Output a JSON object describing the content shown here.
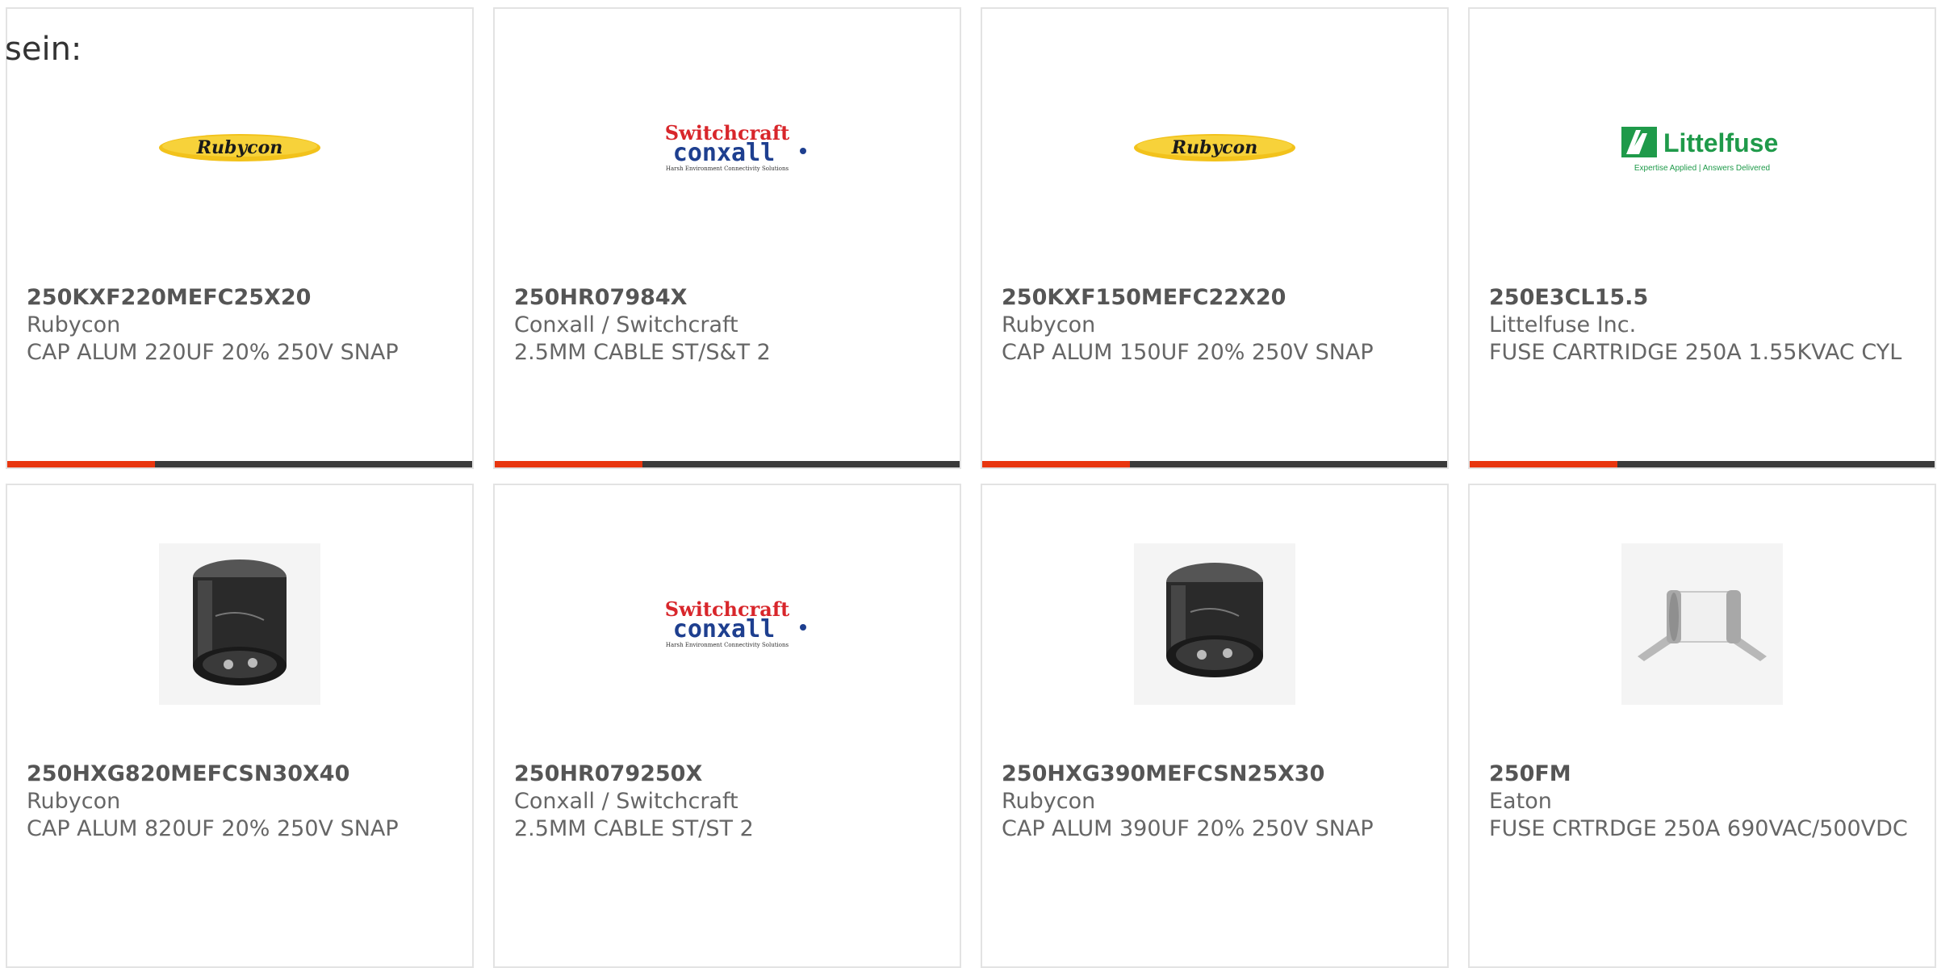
{
  "intro_text": "sein:",
  "colors": {
    "accent": "#e8360f",
    "bar": "#3a3a3a",
    "border": "#e3e3e3",
    "text": "#666666"
  },
  "products": [
    {
      "part_number": "250KXF220MEFC25X20",
      "manufacturer": "Rubycon",
      "description": "CAP ALUM 220UF 20% 250V SNAP",
      "image": "rubycon-logo",
      "logo_text": "Rubycon"
    },
    {
      "part_number": "250HR07984X",
      "manufacturer": "Conxall / Switchcraft",
      "description": "2.5MM CABLE ST/S&T 2",
      "image": "switchcraft-conxall-logo",
      "logo_text": "Switchcraft",
      "logo_text2": "conxall",
      "logo_tagline": "Harsh Environment Connectivity Solutions"
    },
    {
      "part_number": "250KXF150MEFC22X20",
      "manufacturer": "Rubycon",
      "description": "CAP ALUM 150UF 20% 250V SNAP",
      "image": "rubycon-logo",
      "logo_text": "Rubycon"
    },
    {
      "part_number": "250E3CL15.5",
      "manufacturer": "Littelfuse Inc.",
      "description": "FUSE CARTRIDGE 250A 1.55KVAC CYL",
      "image": "littelfuse-logo",
      "logo_text": "Littelfuse",
      "logo_tagline": "Expertise Applied | Answers Delivered"
    },
    {
      "part_number": "250HXG820MEFCSN30X40",
      "manufacturer": "Rubycon",
      "description": "CAP ALUM 820UF 20% 250V SNAP",
      "image": "capacitor-photo"
    },
    {
      "part_number": "250HR079250X",
      "manufacturer": "Conxall / Switchcraft",
      "description": "2.5MM CABLE ST/ST 2",
      "image": "switchcraft-conxall-logo",
      "logo_text": "Switchcraft",
      "logo_text2": "conxall",
      "logo_tagline": "Harsh Environment Connectivity Solutions"
    },
    {
      "part_number": "250HXG390MEFCSN25X30",
      "manufacturer": "Rubycon",
      "description": "CAP ALUM 390UF 20% 250V SNAP",
      "image": "capacitor-photo"
    },
    {
      "part_number": "250FM",
      "manufacturer": "Eaton",
      "description": "FUSE CRTRDGE 250A 690VAC/500VDC",
      "image": "fuse-photo"
    }
  ]
}
